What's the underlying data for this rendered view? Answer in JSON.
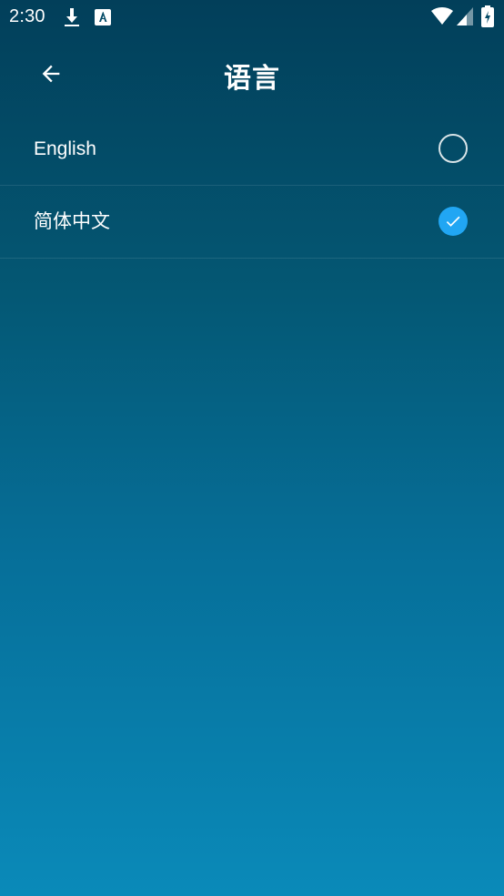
{
  "status_bar": {
    "time": "2:30",
    "icons": [
      "download-icon",
      "keyboard-icon",
      "wifi-icon",
      "signal-icon",
      "battery-icon"
    ]
  },
  "header": {
    "title": "语言",
    "back_icon": "back-arrow-icon"
  },
  "languages": [
    {
      "label": "English",
      "selected": false
    },
    {
      "label": "简体中文",
      "selected": true
    }
  ],
  "colors": {
    "accent": "#21a6f3",
    "gradient_top": "#023f5a",
    "gradient_bottom": "#0a8ab9"
  }
}
